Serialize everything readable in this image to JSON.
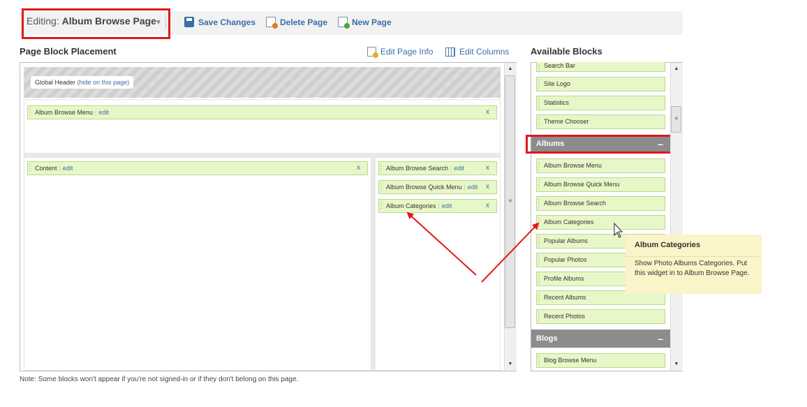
{
  "toolbar": {
    "editing_prefix": "Editing:",
    "page_name": "Album Browse Page",
    "save_label": "Save Changes",
    "delete_label": "Delete Page",
    "new_label": "New Page"
  },
  "placement": {
    "title": "Page Block Placement",
    "edit_page_info": "Edit Page Info",
    "edit_columns": "Edit Columns",
    "global_header": "Global Header",
    "hide_link": "(hide on this page)",
    "top_block": {
      "label": "Album Browse Menu",
      "edit": "edit",
      "remove": "x"
    },
    "main_block": {
      "label": "Content",
      "edit": "edit",
      "remove": "x"
    },
    "right_blocks": [
      {
        "label": "Album Browse Search",
        "edit": "edit",
        "remove": "x"
      },
      {
        "label": "Album Browse Quick Menu",
        "edit": "edit",
        "remove": "x"
      },
      {
        "label": "Album Categories",
        "edit": "edit",
        "remove": "x"
      }
    ],
    "separator": "|"
  },
  "available": {
    "title": "Available Blocks",
    "core_items": [
      "Search Bar",
      "Site Logo",
      "Statistics",
      "Theme Chooser"
    ],
    "albums_label": "Albums",
    "album_items": [
      "Album Browse Menu",
      "Album Browse Quick Menu",
      "Album Browse Search",
      "Album Categories",
      "Popular Albums",
      "Popular Photos",
      "Profile Albums",
      "Recent Albums",
      "Recent Photos"
    ],
    "blogs_label": "Blogs",
    "blog_items": [
      "Blog Browse Menu"
    ],
    "collapse": "–"
  },
  "tooltip": {
    "title": "Album Categories",
    "body": "Show Photo Albums Categories. Put this widget in to Album Browse Page."
  },
  "note": "Note: Some blocks won't appear if you're not signed-in or if they don't belong on this page.",
  "colors": {
    "highlight": "#e3161d",
    "link": "#3b6ea5",
    "block_bg": "#e8f7c8",
    "category_bg": "#8c8c8c",
    "tooltip_bg": "#fbf4c8"
  }
}
